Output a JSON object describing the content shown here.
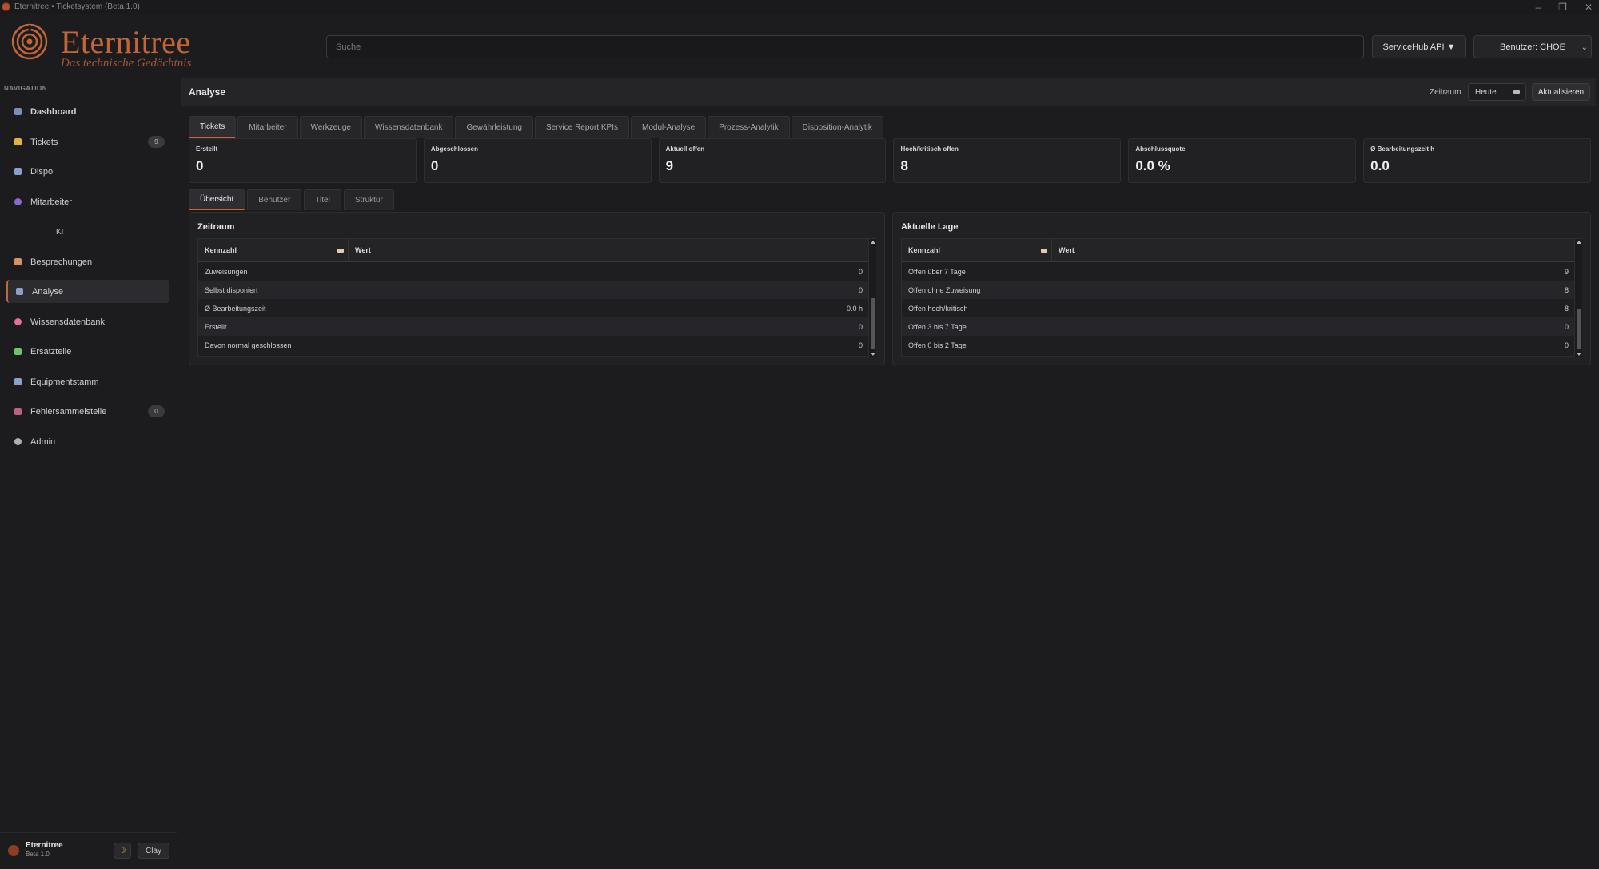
{
  "window": {
    "title": "Eternitree • Ticketsystem (Beta 1.0)",
    "controls": [
      "–",
      "❐",
      "✕"
    ]
  },
  "brand": {
    "name": "Eternitree",
    "tagline": "Das technische Gedächtnis",
    "color": "#c26638"
  },
  "header": {
    "search_placeholder": "Suche",
    "api_button": "ServiceHub API ▼",
    "user_button": "Benutzer: CHOE"
  },
  "sidebar": {
    "heading": "NAVIGATION",
    "items": [
      {
        "label": "Dashboard",
        "icon": "dashboard-icon",
        "color": "#7a8fb8",
        "bold": true
      },
      {
        "label": "Tickets",
        "icon": "ticket-icon",
        "color": "#e0b040",
        "badge": "9"
      },
      {
        "label": "Dispo",
        "icon": "calendar-icon",
        "color": "#8aa0c8"
      },
      {
        "label": "Mitarbeiter",
        "icon": "person-icon",
        "color": "#8a6ac8"
      },
      {
        "label": "Besprechungen",
        "icon": "notes-icon",
        "color": "#d89060"
      },
      {
        "label": "Analyse",
        "icon": "chart-icon",
        "color": "#8aa0c8",
        "active": true
      },
      {
        "label": "Wissensdatenbank",
        "icon": "brain-icon",
        "color": "#e070a0"
      },
      {
        "label": "Ersatzteile",
        "icon": "puzzle-icon",
        "color": "#70c070"
      },
      {
        "label": "Equipmentstamm",
        "icon": "factory-icon",
        "color": "#8aa0c8"
      },
      {
        "label": "Fehlersammelstelle",
        "icon": "bug-icon",
        "color": "#c06080",
        "badge": "0"
      },
      {
        "label": "Admin",
        "icon": "gear-icon",
        "color": "#b0b0b0"
      }
    ],
    "sub_item": "KI",
    "footer": {
      "name": "Eternitree",
      "version": "Beta 1.0",
      "theme_icon": "☽",
      "theme_select": "Clay"
    }
  },
  "page": {
    "title": "Analyse",
    "range_label": "Zeitraum",
    "range_value": "Heute",
    "refresh_label": "Aktualisieren",
    "tabs": [
      "Tickets",
      "Mitarbeiter",
      "Werkzeuge",
      "Wissensdatenbank",
      "Gewährleistung",
      "Service Report KPIs",
      "Modul-Analyse",
      "Prozess-Analytik",
      "Disposition-Analytik"
    ],
    "kpis": [
      {
        "title": "Erstellt",
        "value": "0"
      },
      {
        "title": "Abgeschlossen",
        "value": "0"
      },
      {
        "title": "Aktuell offen",
        "value": "9"
      },
      {
        "title": "Hoch/kritisch offen",
        "value": "8"
      },
      {
        "title": "Abschlussquote",
        "value": "0.0 %"
      },
      {
        "title": "Ø Bearbeitungszeit h",
        "value": "0.0"
      }
    ],
    "subtabs": [
      "Übersicht",
      "Benutzer",
      "Titel",
      "Struktur"
    ],
    "panels": {
      "zeitraum": {
        "title": "Zeitraum",
        "col_key": "Kennzahl",
        "col_val": "Wert",
        "rows": [
          {
            "k": "Zuweisungen",
            "v": "0"
          },
          {
            "k": "Selbst disponiert",
            "v": "0"
          },
          {
            "k": "Ø Bearbeitungszeit",
            "v": "0.0 h"
          },
          {
            "k": "Erstellt",
            "v": "0"
          },
          {
            "k": "Davon normal geschlossen",
            "v": "0"
          }
        ]
      },
      "lage": {
        "title": "Aktuelle Lage",
        "col_key": "Kennzahl",
        "col_val": "Wert",
        "rows": [
          {
            "k": "Offen über 7 Tage",
            "v": "9"
          },
          {
            "k": "Offen ohne Zuweisung",
            "v": "8"
          },
          {
            "k": "Offen hoch/kritisch",
            "v": "8"
          },
          {
            "k": "Offen 3 bis 7 Tage",
            "v": "0"
          },
          {
            "k": "Offen 0 bis 2 Tage",
            "v": "0"
          }
        ]
      }
    }
  }
}
